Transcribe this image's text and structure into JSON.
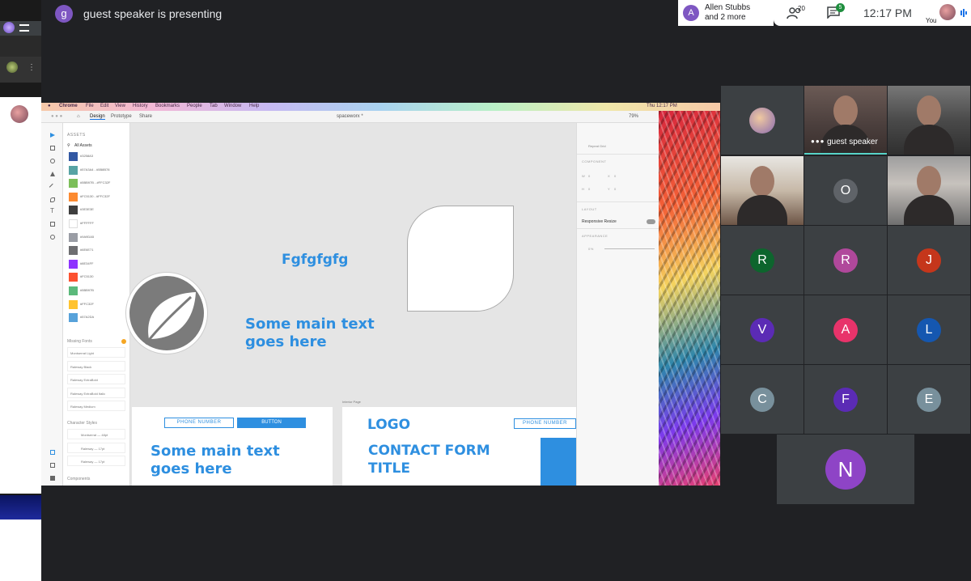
{
  "top_bar": {
    "presenter_initial": "g",
    "presenter_text": "guest speaker is presenting",
    "joined_initial": "A",
    "joined_name": "Allen Stubbs",
    "joined_more": "and 2 more",
    "people_count": "20",
    "chat_badge": "5",
    "time": "12:17 PM",
    "you_label": "You",
    "icons": [
      "people-icon",
      "chat-icon",
      "mic-icon"
    ]
  },
  "shared_screen": {
    "mac_menu": [
      "Chrome",
      "File",
      "Edit",
      "View",
      "History",
      "Bookmarks",
      "People",
      "Tab",
      "Window",
      "Help"
    ],
    "mac_clock": "Thu 12:17 PM",
    "app_tabs": [
      "Design",
      "Prototype",
      "Share"
    ],
    "doc_title": "spaceworx *",
    "zoom": "79%",
    "assets": {
      "header": "ASSETS",
      "filter": "All Assets",
      "colors": [
        {
          "label": "#3258A3",
          "hex": "#3258a3"
        },
        {
          "label": "#57A3A4 - #5B8B78",
          "hex": "#57a3a4"
        },
        {
          "label": "#5BB97B - #FFC32F",
          "hex": "#7cbf5a"
        },
        {
          "label": "#FC5130 - #FFC32F",
          "hex": "#fc8a30"
        },
        {
          "label": "#3E3E3E",
          "hex": "#3e3e3e"
        },
        {
          "label": "#FFFFFF",
          "hex": "#ffffff"
        },
        {
          "label": "#9A9DA5",
          "hex": "#9a9da5"
        },
        {
          "label": "#6E6E71",
          "hex": "#6e6e71"
        },
        {
          "label": "#8E34FF",
          "hex": "#8e34ff"
        },
        {
          "label": "#FC5130",
          "hex": "#fc5130"
        },
        {
          "label": "#5BB97B",
          "hex": "#5bb97b"
        },
        {
          "label": "#FFC32F",
          "hex": "#ffc32f"
        },
        {
          "label": "#57A2DA",
          "hex": "#57a2da"
        }
      ],
      "missing_fonts_header": "Missing Fonts",
      "fonts": [
        "Montserrat Light",
        "Raleway Black",
        "Raleway ExtraBold",
        "Raleway ExtraBold Italic",
        "Raleway Medium"
      ],
      "char_styles_header": "Character Styles",
      "char_styles": [
        "Montserrat — 48pt",
        "Raleway — 17pt",
        "Raleway — 17pt"
      ],
      "components_header": "Components"
    },
    "canvas": {
      "heading_small": "Fgfgfgfg",
      "main_text_1": "Some main text",
      "main_text_2": "goes here",
      "artboard_label": "Interior Page",
      "phone_btn": "PHONE NUMBER",
      "button_btn": "BUTTON",
      "main_text_3": "Some main text",
      "main_text_4": "goes here",
      "logo": "LOGO",
      "contact_1": "CONTACT FORM",
      "contact_2": "TITLE",
      "phone_btn_2": "PHONE NUMBER"
    },
    "props": {
      "repeat_grid": "Repeat Grid",
      "component": "COMPONENT",
      "w": "W",
      "x": "X",
      "h": "H",
      "y": "Y",
      "zero_1": "0",
      "zero_2": "0",
      "zero_3": "0",
      "zero_4": "0",
      "layout": "LAYOUT",
      "responsive": "Responsive Resize",
      "appearance": "APPEARANCE",
      "opacity": "0%"
    }
  },
  "participants": [
    {
      "id": "avatar-1",
      "type": "avatar"
    },
    {
      "id": "guest-speaker",
      "type": "video",
      "caption": "guest speaker"
    },
    {
      "id": "video-2",
      "type": "video"
    },
    {
      "id": "video-3",
      "type": "video"
    },
    {
      "id": "o",
      "type": "initial",
      "initial": "O",
      "color": "#5f6368"
    },
    {
      "id": "video-4",
      "type": "video"
    },
    {
      "id": "r1",
      "type": "initial",
      "initial": "R",
      "color": "#0d652d"
    },
    {
      "id": "r2",
      "type": "initial",
      "initial": "R",
      "color": "#b0489b"
    },
    {
      "id": "j",
      "type": "initial",
      "initial": "J",
      "color": "#c5361b"
    },
    {
      "id": "v",
      "type": "initial",
      "initial": "V",
      "color": "#5b2bb5"
    },
    {
      "id": "a",
      "type": "initial",
      "initial": "A",
      "color": "#e8336a"
    },
    {
      "id": "l",
      "type": "initial",
      "initial": "L",
      "color": "#1557b0"
    },
    {
      "id": "c",
      "type": "initial",
      "initial": "C",
      "color": "#78909c"
    },
    {
      "id": "f",
      "type": "initial",
      "initial": "F",
      "color": "#5b2bb5"
    },
    {
      "id": "e",
      "type": "initial",
      "initial": "E",
      "color": "#78909c"
    },
    {
      "id": "n",
      "type": "initial",
      "initial": "N",
      "color": "#8e44c6"
    }
  ]
}
